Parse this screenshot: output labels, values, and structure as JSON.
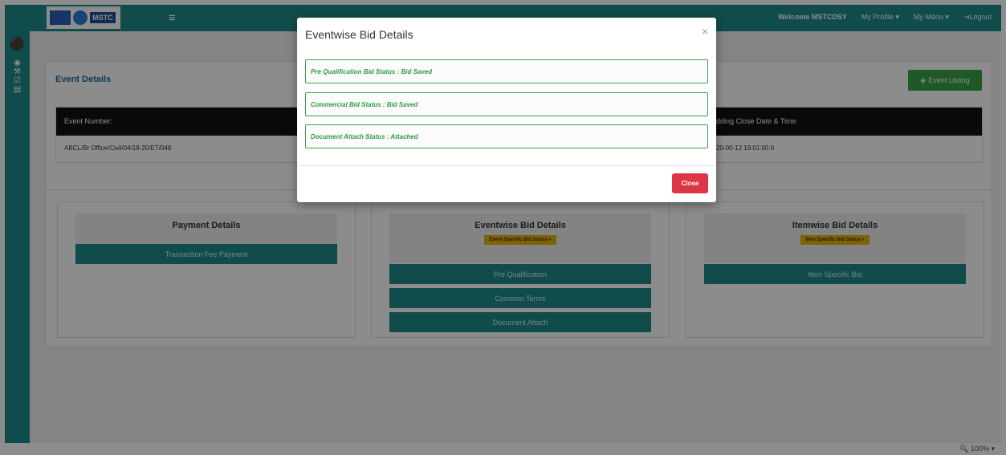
{
  "header": {
    "logo_text": "MSTC",
    "welcome": "Welcome MSTCDSY",
    "my_profile": "My Profile ▾",
    "my_menu": "My Menu ▾",
    "logout": "⇥Logout"
  },
  "event_details": {
    "title": "Event Details",
    "event_listing_label": "Event Listing",
    "table": {
      "col1_header": "Event Number:",
      "col2_header": "dding Close Date & Time",
      "col1_value": "ABCL/Br Office/Civil/04/18-20/ET/048",
      "col2_value": "20-00-12 18:01:00.0"
    }
  },
  "payment_details": {
    "title": "Payment Details",
    "transaction_btn": "Transaction Fee Payment"
  },
  "eventwise_panel": {
    "title": "Eventwise Bid Details",
    "badge": "Event Specific Bid Status »",
    "buttons": [
      "Pre Qualification",
      "Common Terms",
      "Document Attach"
    ]
  },
  "itemwise_panel": {
    "title": "Itemwise Bid Details",
    "badge": "Item Specific Bid Status »",
    "button": "Item Specific Bid"
  },
  "modal": {
    "title": "Eventwise Bid Details",
    "close_x": "×",
    "rows": [
      "Pre Qualification Bid Status : Bid Saved",
      "Commercial Bid Status : Bid Saved",
      "Document Attach Status : Attached"
    ],
    "close_button": "Close"
  },
  "statusbar": {
    "zoom": "🔍 100%  ▾"
  },
  "colors": {
    "teal": "#1f8a8a",
    "success": "#3aa34a",
    "danger": "#dc3545",
    "badge": "#e6b400"
  }
}
